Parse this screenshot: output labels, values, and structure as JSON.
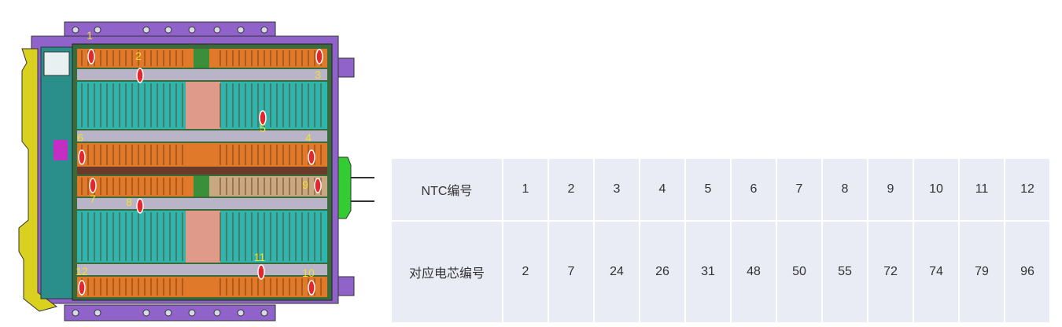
{
  "colors": {
    "module_orange": "#e07a2a",
    "cell_teal": "#2bb7b0",
    "frame_purple": "#8f63c9",
    "bracket_yellow": "#d9d020",
    "marker_red": "#e8252b",
    "label_yellow": "#f0e030",
    "table_bg": "#e9ecf4"
  },
  "diagram": {
    "ntc_markers": [
      {
        "label": "1"
      },
      {
        "label": "2"
      },
      {
        "label": "3"
      },
      {
        "label": "4"
      },
      {
        "label": "5"
      },
      {
        "label": "6"
      },
      {
        "label": "7"
      },
      {
        "label": "8"
      },
      {
        "label": "9"
      },
      {
        "label": "10"
      },
      {
        "label": "11"
      },
      {
        "label": "12"
      }
    ]
  },
  "table": {
    "row1_label": "NTC编号",
    "row2_label": "对应电芯编号",
    "ntc_numbers": [
      "1",
      "2",
      "3",
      "4",
      "5",
      "6",
      "7",
      "8",
      "9",
      "10",
      "11",
      "12"
    ],
    "cell_numbers": [
      "2",
      "7",
      "24",
      "26",
      "31",
      "48",
      "50",
      "55",
      "72",
      "74",
      "79",
      "96"
    ]
  }
}
